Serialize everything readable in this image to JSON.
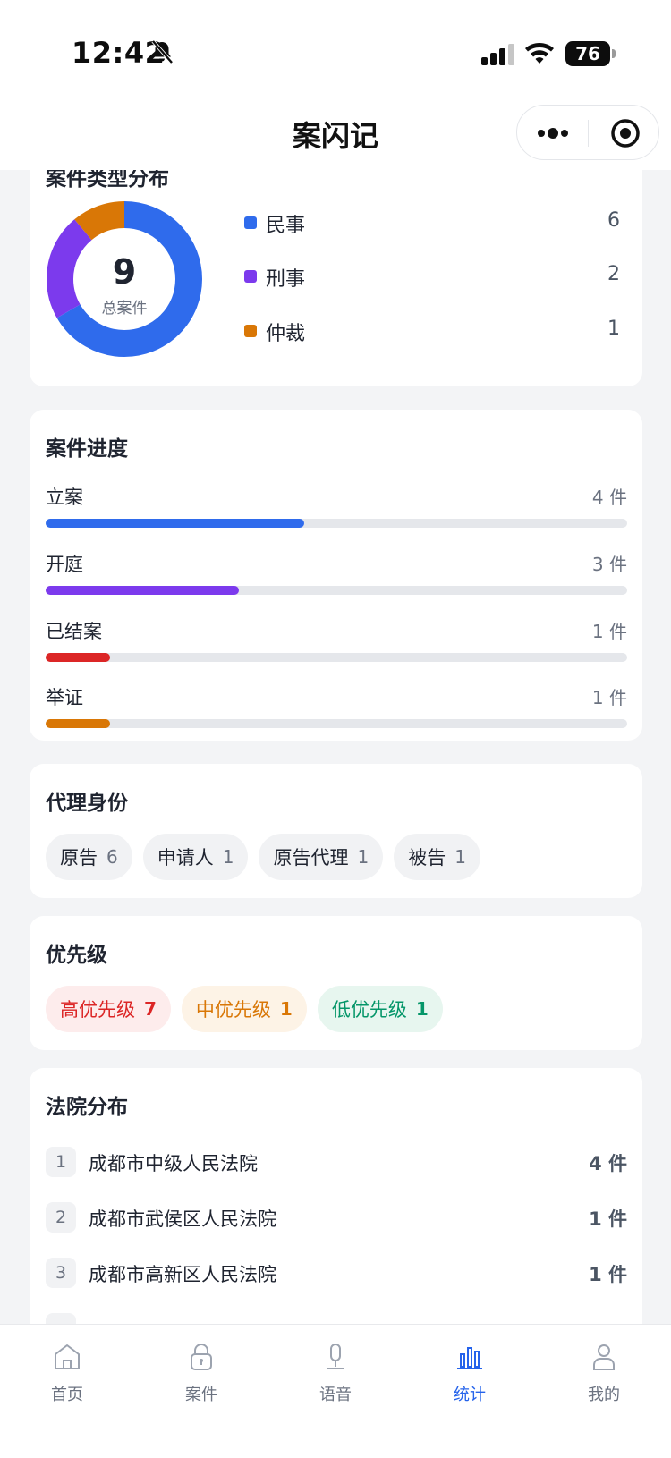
{
  "status": {
    "time": "12:42",
    "battery": "76"
  },
  "nav": {
    "title": "案闪记"
  },
  "type_dist": {
    "title": "案件类型分布",
    "total": "9",
    "total_label": "总案件",
    "items": [
      {
        "label": "民事",
        "value": "6",
        "count": 6,
        "color": "#2f6bec"
      },
      {
        "label": "刑事",
        "value": "2",
        "count": 2,
        "color": "#7c3aed"
      },
      {
        "label": "仲裁",
        "value": "1",
        "count": 1,
        "color": "#d97706"
      }
    ]
  },
  "progress": {
    "title": "案件进度",
    "items": [
      {
        "label": "立案",
        "count_text": "4 件",
        "fraction": 0.444,
        "color": "#2f6bec"
      },
      {
        "label": "开庭",
        "count_text": "3 件",
        "fraction": 0.333,
        "color": "#7c3aed"
      },
      {
        "label": "已结案",
        "count_text": "1 件",
        "fraction": 0.111,
        "color": "#dc2626"
      },
      {
        "label": "举证",
        "count_text": "1 件",
        "fraction": 0.111,
        "color": "#d97706"
      }
    ]
  },
  "roles": {
    "title": "代理身份",
    "items": [
      {
        "label": "原告",
        "count": "6"
      },
      {
        "label": "申请人",
        "count": "1"
      },
      {
        "label": "原告代理",
        "count": "1"
      },
      {
        "label": "被告",
        "count": "1"
      }
    ]
  },
  "priority": {
    "title": "优先级",
    "items": [
      {
        "label": "高优先级",
        "count": "7",
        "bg": "#fdecec",
        "fg": "#dc2626"
      },
      {
        "label": "中优先级",
        "count": "1",
        "bg": "#fdf3e6",
        "fg": "#d97706"
      },
      {
        "label": "低优先级",
        "count": "1",
        "bg": "#e7f6ef",
        "fg": "#059669"
      }
    ]
  },
  "courts": {
    "title": "法院分布",
    "items": [
      {
        "index": "1",
        "name": "成都市中级人民法院",
        "count": "4 件"
      },
      {
        "index": "2",
        "name": "成都市武侯区人民法院",
        "count": "1 件"
      },
      {
        "index": "3",
        "name": "成都市高新区人民法院",
        "count": "1 件"
      }
    ]
  },
  "tabbar": {
    "items": [
      {
        "label": "首页",
        "icon": "home-icon"
      },
      {
        "label": "案件",
        "icon": "lock-icon"
      },
      {
        "label": "语音",
        "icon": "microphone-icon"
      },
      {
        "label": "统计",
        "icon": "bar-chart-icon",
        "active": true
      },
      {
        "label": "我的",
        "icon": "user-icon"
      }
    ]
  }
}
